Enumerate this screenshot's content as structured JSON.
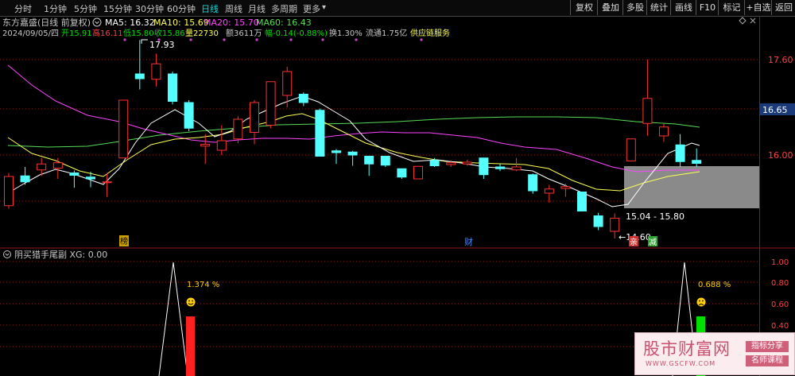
{
  "toolbar": {
    "periods": [
      {
        "label": "分时"
      },
      {
        "label": "1分钟"
      },
      {
        "label": "5分钟"
      },
      {
        "label": "15分钟"
      },
      {
        "label": "30分钟"
      },
      {
        "label": "60分钟"
      },
      {
        "label": "日线"
      },
      {
        "label": "周线"
      },
      {
        "label": "月线"
      },
      {
        "label": "多周期"
      },
      {
        "label": "更多"
      }
    ],
    "active_period": "日线",
    "right_buttons": [
      {
        "label": "复权"
      },
      {
        "label": "叠加"
      },
      {
        "label": "多股"
      },
      {
        "label": "统计"
      },
      {
        "label": "画线"
      },
      {
        "label": "F10"
      },
      {
        "label": "标记"
      },
      {
        "label": "+自选"
      },
      {
        "label": "返回"
      }
    ]
  },
  "header": {
    "title": "东方嘉盛(日线 前复权)",
    "ma": [
      {
        "label": "MA5: 16.32",
        "color": "#ffffff"
      },
      {
        "label": "MA10: 15.69",
        "color": "#ffff55"
      },
      {
        "label": "MA20: 15.70",
        "color": "#ff44ff"
      },
      {
        "label": "MA60: 16.43",
        "color": "#55dd55"
      }
    ],
    "info": [
      {
        "text": "2024/09/05/四",
        "color": "#c8c8c8"
      },
      {
        "text": "开15.91",
        "color": "#00e000"
      },
      {
        "text": "高16.11",
        "color": "#ff4040"
      },
      {
        "text": "低15.80",
        "color": "#00e000"
      },
      {
        "text": "收15.86",
        "color": "#00e000"
      },
      {
        "text": "量22730",
        "color": "#ffff55"
      },
      {
        "text": "额3611万",
        "color": "#c8c8c8"
      },
      {
        "text": "幅-0.14(-0.88%)",
        "color": "#00e000"
      },
      {
        "text": "换1.30%",
        "color": "#c8c8c8"
      },
      {
        "text": "流通1.75亿",
        "color": "#c8c8c8"
      },
      {
        "text": "供应链服务",
        "color": "#ffff55"
      }
    ]
  },
  "price_axis": [
    "17.60",
    "16.65",
    "16.00"
  ],
  "price_highlight": "16.65",
  "annotations": {
    "high": "17.93",
    "low": "←14.60",
    "range_box": "15.04 - 15.80"
  },
  "markers": {
    "a": "榜",
    "b": "财",
    "c": "亲",
    "d": "减"
  },
  "indicator": {
    "title": "阴买猎手尾副 XG: 0.00",
    "axis": [
      "1.00",
      "0.80",
      "0.60",
      "0.40"
    ],
    "signals": [
      {
        "pct": "1.374 %",
        "bar_color": "#ff2020",
        "face_color": "#ffd000"
      },
      {
        "pct": "0.688 %",
        "bar_color": "#00e000",
        "face_color": "#ffd000"
      }
    ]
  },
  "watermark": {
    "site": "股市财富网",
    "url": "WWW.GSCFW.COM",
    "tag1": "指标分享",
    "tag2": "名师课程"
  },
  "chart_data": {
    "type": "candlestick",
    "ylim": [
      14.4,
      18.1
    ],
    "candles": [
      {
        "o": 15.15,
        "c": 15.64,
        "h": 15.7,
        "l": 15.1
      },
      {
        "o": 15.65,
        "c": 15.55,
        "h": 15.8,
        "l": 15.5
      },
      {
        "o": 15.75,
        "c": 15.85,
        "h": 15.95,
        "l": 15.65
      },
      {
        "o": 15.78,
        "c": 15.87,
        "h": 15.95,
        "l": 15.6
      },
      {
        "o": 15.7,
        "c": 15.66,
        "h": 15.74,
        "l": 15.45
      },
      {
        "o": 15.63,
        "c": 15.6,
        "h": 15.72,
        "l": 15.46
      },
      {
        "o": 15.55,
        "c": 15.55,
        "h": 15.7,
        "l": 15.3
      },
      {
        "o": 15.95,
        "c": 16.92,
        "h": 16.92,
        "l": 15.95
      },
      {
        "o": 17.36,
        "c": 17.28,
        "h": 17.93,
        "l": 17.1
      },
      {
        "o": 17.27,
        "c": 17.53,
        "h": 17.7,
        "l": 17.15
      },
      {
        "o": 17.36,
        "c": 16.9,
        "h": 17.4,
        "l": 16.85
      },
      {
        "o": 16.88,
        "c": 16.45,
        "h": 16.92,
        "l": 16.4
      },
      {
        "o": 16.15,
        "c": 16.18,
        "h": 16.35,
        "l": 15.85
      },
      {
        "o": 16.08,
        "c": 16.24,
        "h": 16.5,
        "l": 16.0
      },
      {
        "o": 16.27,
        "c": 16.6,
        "h": 16.65,
        "l": 16.2
      },
      {
        "o": 16.38,
        "c": 16.88,
        "h": 16.92,
        "l": 16.18
      },
      {
        "o": 16.5,
        "c": 17.23,
        "h": 17.23,
        "l": 16.45
      },
      {
        "o": 17.0,
        "c": 17.4,
        "h": 17.48,
        "l": 16.8
      },
      {
        "o": 17.02,
        "c": 16.88,
        "h": 17.05,
        "l": 16.82
      },
      {
        "o": 16.75,
        "c": 15.98,
        "h": 16.78,
        "l": 15.98
      },
      {
        "o": 16.07,
        "c": 16.04,
        "h": 16.1,
        "l": 15.85
      },
      {
        "o": 16.05,
        "c": 16.0,
        "h": 16.07,
        "l": 15.82
      },
      {
        "o": 15.98,
        "c": 15.85,
        "h": 15.98,
        "l": 15.65
      },
      {
        "o": 15.98,
        "c": 15.83,
        "h": 15.98,
        "l": 15.8
      },
      {
        "o": 15.77,
        "c": 15.63,
        "h": 15.77,
        "l": 15.6
      },
      {
        "o": 15.6,
        "c": 15.81,
        "h": 15.81,
        "l": 15.6
      },
      {
        "o": 15.91,
        "c": 15.82,
        "h": 15.95,
        "l": 15.8
      },
      {
        "o": 15.84,
        "c": 15.87,
        "h": 15.91,
        "l": 15.8
      },
      {
        "o": 15.85,
        "c": 15.88,
        "h": 15.92,
        "l": 15.82
      },
      {
        "o": 15.95,
        "c": 15.67,
        "h": 15.95,
        "l": 15.6
      },
      {
        "o": 15.8,
        "c": 15.77,
        "h": 15.85,
        "l": 15.73
      },
      {
        "o": 15.75,
        "c": 15.8,
        "h": 15.95,
        "l": 15.73
      },
      {
        "o": 15.67,
        "c": 15.4,
        "h": 15.69,
        "l": 15.35
      },
      {
        "o": 15.36,
        "c": 15.43,
        "h": 15.5,
        "l": 15.2
      },
      {
        "o": 15.44,
        "c": 15.47,
        "h": 15.52,
        "l": 15.3
      },
      {
        "o": 15.38,
        "c": 15.06,
        "h": 15.38,
        "l": 15.06
      },
      {
        "o": 14.98,
        "c": 14.8,
        "h": 15.03,
        "l": 14.74
      },
      {
        "o": 14.72,
        "c": 14.94,
        "h": 15.02,
        "l": 14.6
      },
      {
        "o": 15.9,
        "c": 16.27,
        "h": 16.27,
        "l": 15.89
      },
      {
        "o": 16.53,
        "c": 16.95,
        "h": 17.6,
        "l": 16.32
      },
      {
        "o": 16.32,
        "c": 16.47,
        "h": 16.52,
        "l": 16.22
      },
      {
        "o": 16.17,
        "c": 15.89,
        "h": 16.35,
        "l": 15.8
      },
      {
        "o": 15.91,
        "c": 15.86,
        "h": 16.11,
        "l": 15.8
      }
    ]
  }
}
